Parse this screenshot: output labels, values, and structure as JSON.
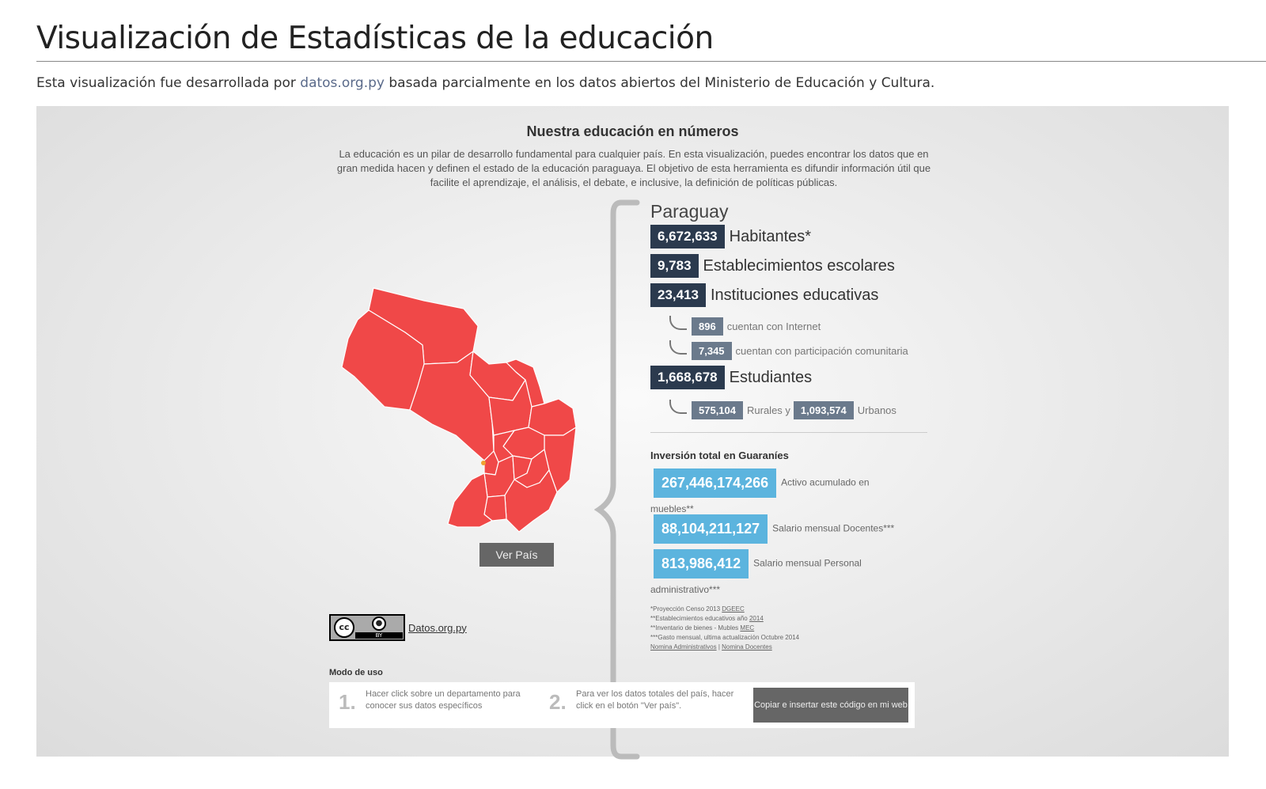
{
  "page": {
    "title": "Visualización de Estadísticas de la educación",
    "intro_before": "Esta visualización fue desarrollada por ",
    "intro_link": "datos.org.py",
    "intro_after": " basada parcialmente en los datos abiertos del Ministerio de Educación y Cultura."
  },
  "widget": {
    "title": "Nuestra educación en números",
    "description": "La educación es un pilar de desarrollo fundamental para cualquier país. En esta visualización, puedes encontrar los datos que en gran medida hacen y definen el estado de la educación paraguaya. El objetivo de esta herramienta es difundir información útil que facilite el aprendizaje, el análisis, el debate, e inclusive, la definición de políticas públicas.",
    "map_color": "#f04848",
    "ver_pais_label": "Ver País",
    "country": "Paraguay",
    "stats": {
      "habitantes_value": "6,672,633",
      "habitantes_label": "Habitantes*",
      "establecimientos_value": "9,783",
      "establecimientos_label": "Establecimientos escolares",
      "instituciones_value": "23,413",
      "instituciones_label": "Instituciones educativas",
      "internet_value": "896",
      "internet_label": "cuentan con Internet",
      "comunitaria_value": "7,345",
      "comunitaria_label": "cuentan con participación comunitaria",
      "estudiantes_value": "1,668,678",
      "estudiantes_label": "Estudiantes",
      "rurales_value": "575,104",
      "rurales_label": "Rurales y",
      "urbanos_value": "1,093,574",
      "urbanos_label": "Urbanos"
    },
    "investment": {
      "heading": "Inversión total en Guaraníes",
      "activo_value": "267,446,174,266",
      "activo_label": "Activo acumulado en muebles**",
      "docentes_value": "88,104,211,127",
      "docentes_label": "Salario mensual Docentes***",
      "personal_value": "813,986,412",
      "personal_label": "Salario mensual Personal administrativo***"
    },
    "footnotes": {
      "line1": "*Proyección Censo 2013 ",
      "line1_link": "DGEEC",
      "line2": "**Establecimientos educativos año ",
      "line2_link": "2014",
      "line3": "**Inventario de bienes - Mubles ",
      "line3_link": "MEC",
      "line4": "***Gasto mensual, ultima actualización Octubre 2014",
      "link_admin": "Nomina Administrativos",
      "separator": " | ",
      "link_docentes": "Nomina Docentes"
    },
    "cc": {
      "cc_text": "cc",
      "by_text": "BY",
      "link": "Datos.org.py"
    },
    "usage": {
      "title": "Modo de uso",
      "step1_num": "1.",
      "step1_text": "Hacer click sobre un departamento para conocer sus datos específicos",
      "step2_num": "2.",
      "step2_text": "Para ver los datos totales del país, hacer click en el botón \"Ver país\".",
      "copy_button": "Copiar e insertar este código en mi web"
    }
  }
}
